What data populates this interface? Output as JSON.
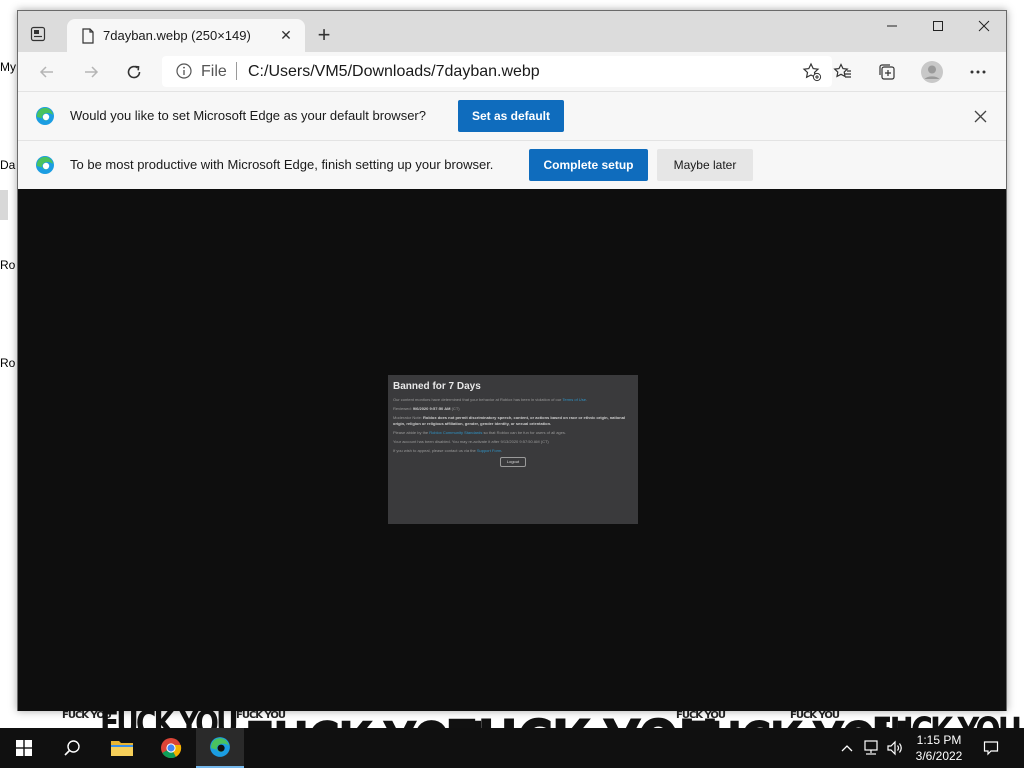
{
  "desktop": {
    "icon_labels": [
      "My",
      "Da",
      "Ro",
      "Ro"
    ],
    "wallpaper_text": {
      "big": "FUCK YOU",
      "small": "FUCK YOU"
    }
  },
  "browser": {
    "tab": {
      "title": "7dayban.webp (250×149)",
      "close_glyph": "✕"
    },
    "new_tab_glyph": "+",
    "address": {
      "scheme": "File",
      "url": "C:/Users/VM5/Downloads/7dayban.webp"
    },
    "infobar_default": {
      "message": "Would you like to set Microsoft Edge as your default browser?",
      "action_label": "Set as default"
    },
    "infobar_setup": {
      "message": "To be most productive with Microsoft Edge, finish setting up your browser.",
      "primary_label": "Complete setup",
      "secondary_label": "Maybe later"
    },
    "image": {
      "title": "Banned for 7 Days",
      "p1_a": "Our content monitors have determined that your behavior at Roblox has been in violation of our ",
      "p1_link": "Terms of Use",
      "p1_b": ".",
      "reviewed_label": "Reviewed:",
      "reviewed_value": "9/6/2020 9:57:50 AM",
      "reviewed_tz": "(CT)",
      "p3_label": "Moderator Note:",
      "p3_text": "Roblox does not permit discriminatory speech, content, or actions based on race or ethnic origin, national origin, religion or religious affiliation, gender, gender identity, or sexual orientation.",
      "p4_a": "Please abide by the ",
      "p4_link": "Roblox Community Standards",
      "p4_b": " so that Roblox can be fun for users of all ages.",
      "p5_text": "Your account has been disabled. You may re-activate it after 9/13/2020 9:57:50 AM (CT)",
      "p6_a": "If you wish to appeal, please contact us via the ",
      "p6_link": "Support Form",
      "p6_b": ".",
      "logout_label": "Logout"
    }
  },
  "taskbar": {
    "time": "1:15 PM",
    "date": "3/6/2022"
  },
  "colors": {
    "edge_blue": "#0f6cbd",
    "taskbar": "#101010",
    "image_bg": "#3a3a3c"
  }
}
